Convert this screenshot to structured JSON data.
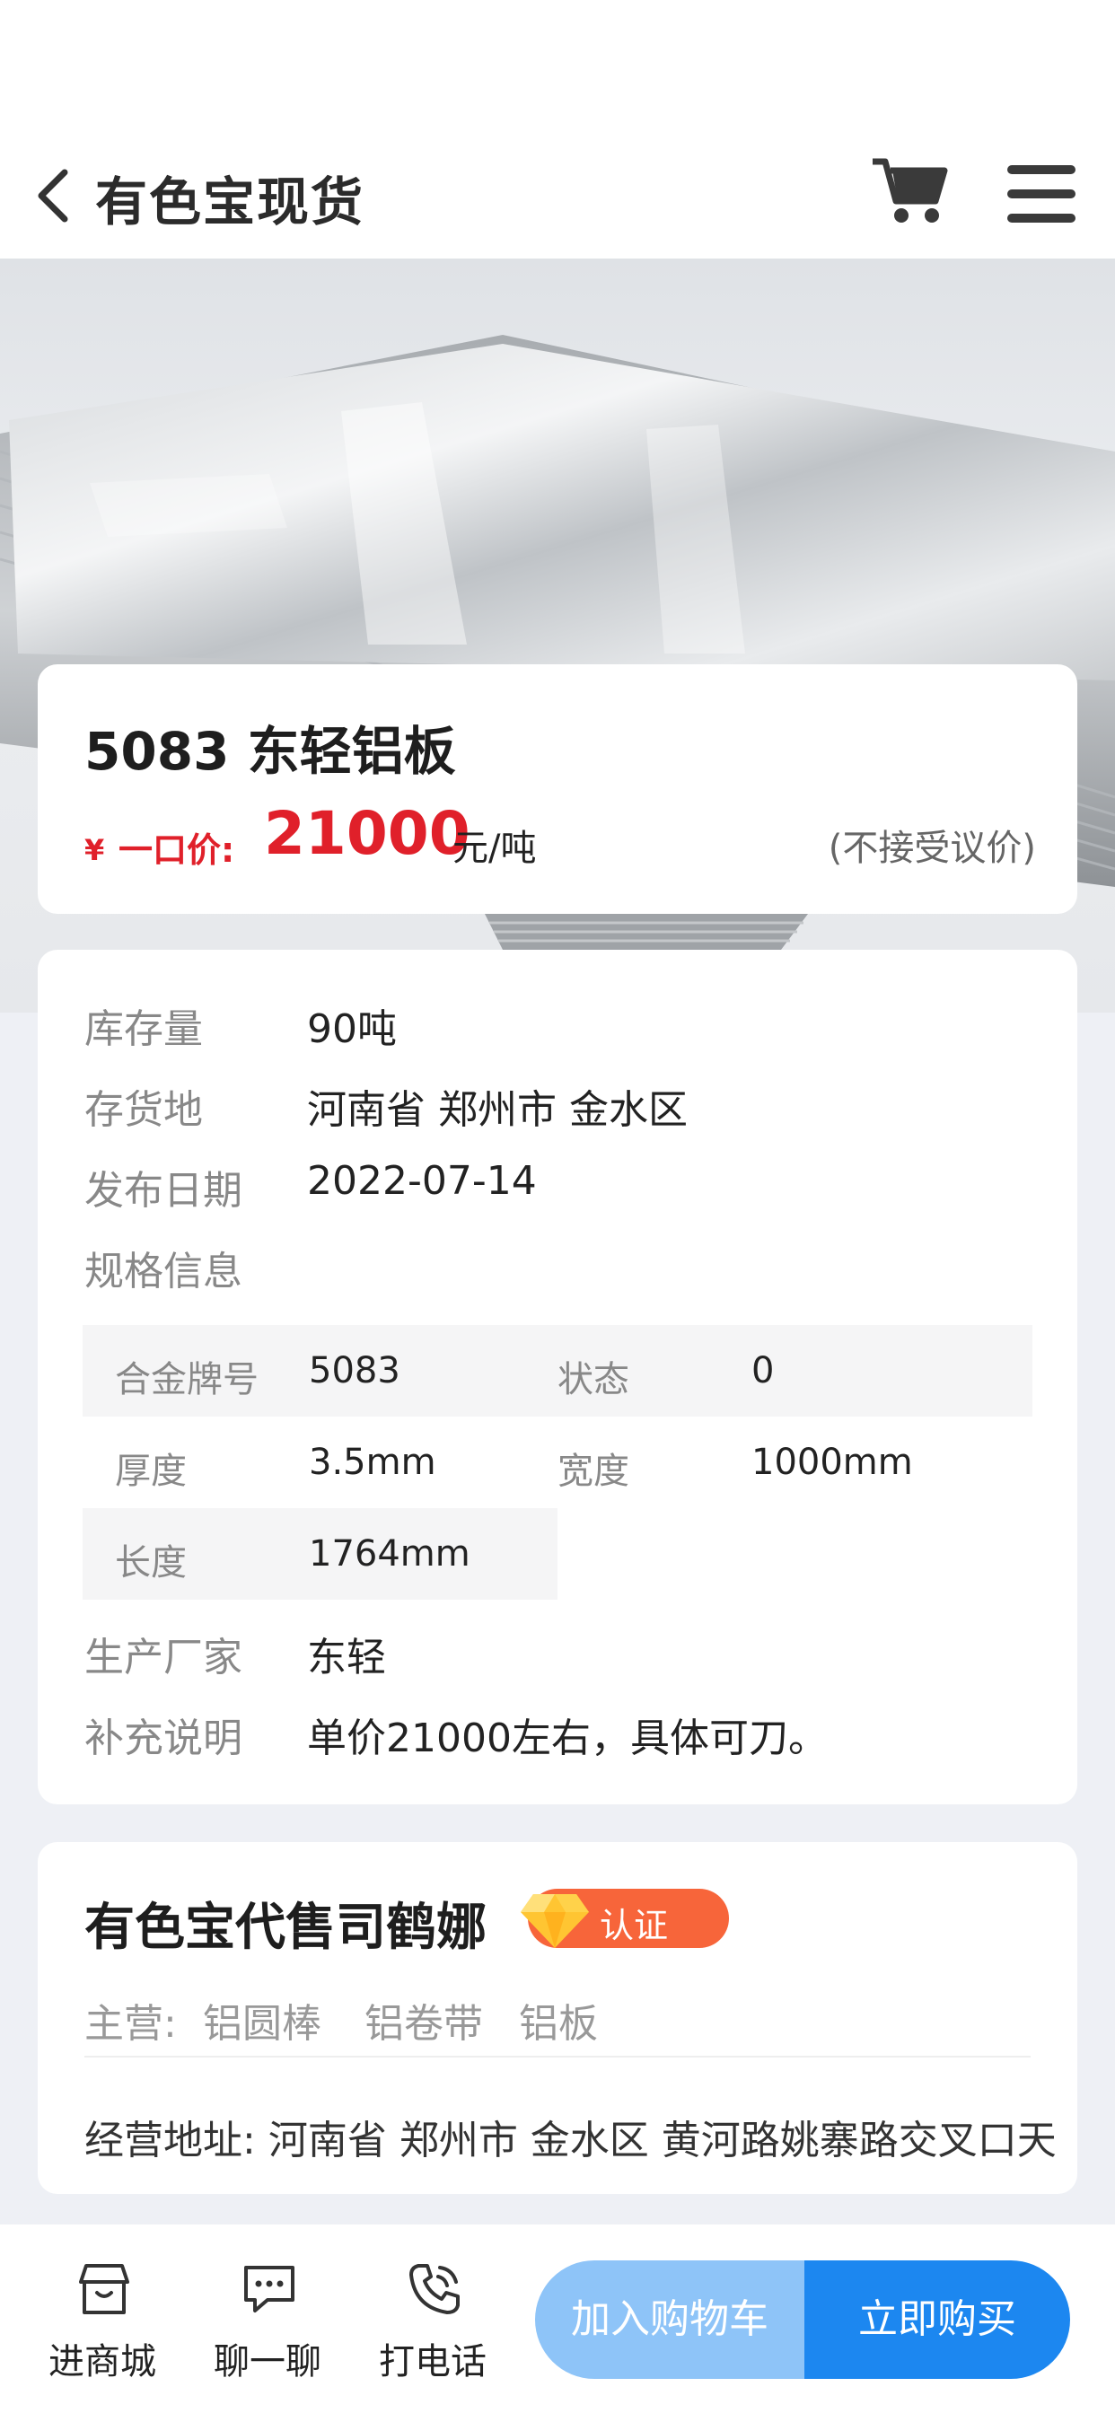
{
  "header": {
    "title": "有色宝现货"
  },
  "product": {
    "name": "5083 东轻铝板",
    "currency_symbol": "¥",
    "price_label": "一口价:",
    "price": "21000",
    "unit": "元/吨",
    "bargain_note": "(不接受议价)"
  },
  "info": {
    "rows": [
      {
        "label": "库存量",
        "value": "90吨"
      },
      {
        "label": "存货地",
        "value": "河南省 郑州市 金水区"
      },
      {
        "label": "发布日期",
        "value": "2022-07-14"
      },
      {
        "label": "规格信息",
        "value": ""
      }
    ],
    "specs": [
      {
        "label": "合金牌号",
        "value": "5083"
      },
      {
        "label": "状态",
        "value": "0"
      },
      {
        "label": "厚度",
        "value": "3.5mm"
      },
      {
        "label": "宽度",
        "value": "1000mm"
      },
      {
        "label": "长度",
        "value": "1764mm"
      }
    ],
    "manufacturer": {
      "label": "生产厂家",
      "value": "东轻"
    },
    "note": {
      "label": "补充说明",
      "value": "单价21000左右，具体可刀。"
    }
  },
  "seller": {
    "name": "有色宝代售司鹤娜",
    "badge": "认证",
    "main_label": "主营:",
    "main_items": [
      "铝圆棒",
      "铝卷带",
      "铝板"
    ],
    "address_label": "经营地址:",
    "address": "河南省 郑州市 金水区 黄河路姚寨路交叉口天"
  },
  "bottom_bar": {
    "store_label": "进商城",
    "chat_label": "聊一聊",
    "call_label": "打电话",
    "add_cart_label": "加入购物车",
    "buy_now_label": "立即购买"
  },
  "colors": {
    "price_red": "#e0202a",
    "primary_blue": "#1c87f0",
    "light_blue": "#8ec4f8",
    "badge_orange": "#f7653a"
  }
}
